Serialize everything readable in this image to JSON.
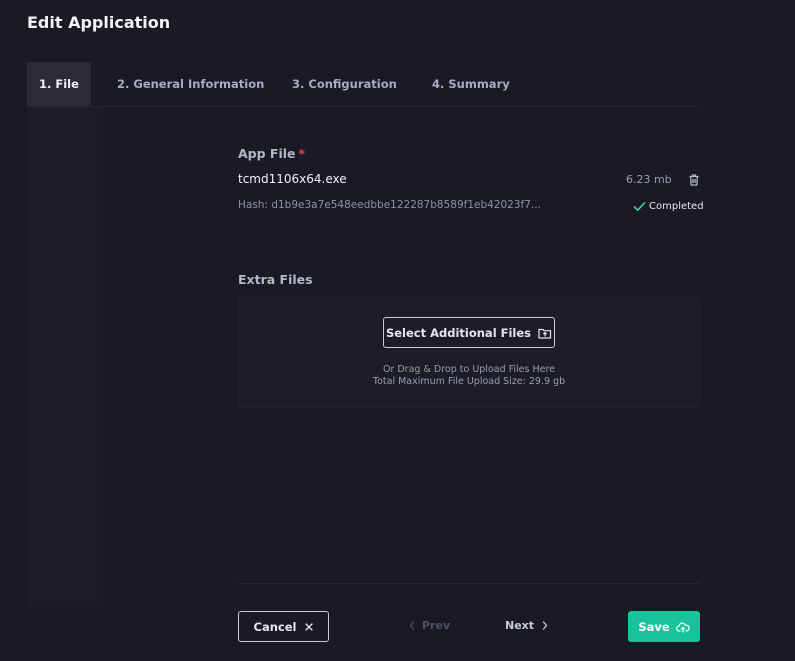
{
  "page": {
    "title": "Edit Application"
  },
  "tabs": [
    {
      "label": "1. File",
      "active": true
    },
    {
      "label": "2. General Information",
      "active": false
    },
    {
      "label": "3. Configuration",
      "active": false
    },
    {
      "label": "4. Summary",
      "active": false
    }
  ],
  "app_file": {
    "label": "App File",
    "required_mark": "*",
    "file_name": "tcmd1106x64.exe",
    "file_size": "6.23 mb",
    "hash": "Hash: d1b9e3a7e548eedbbe122287b8589f1eb42023f7...",
    "status": "Completed"
  },
  "extra_files": {
    "label": "Extra Files",
    "select_button": "Select Additional Files",
    "drop_hint": "Or Drag & Drop to Upload Files Here",
    "max_size": "Total Maximum File Upload Size: 29.9 gb"
  },
  "footer": {
    "cancel": "Cancel",
    "prev": "Prev",
    "next": "Next",
    "save": "Save"
  },
  "colors": {
    "background": "#1a1a24",
    "accent": "#16c39a",
    "required": "#e5484d",
    "success_check": "#3ccf8e"
  },
  "icons": {
    "delete": "trash-icon",
    "status": "check-icon",
    "select_files": "file-upload-icon",
    "cancel": "close-icon",
    "prev": "chevron-left-icon",
    "next": "chevron-right-icon",
    "save": "cloud-upload-icon"
  }
}
